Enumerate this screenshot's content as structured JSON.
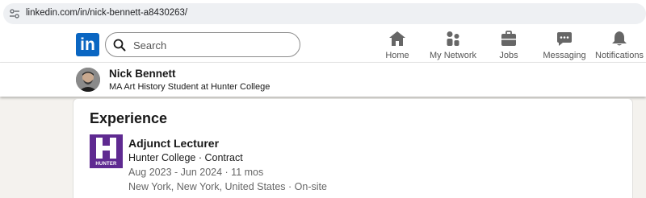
{
  "browser": {
    "url": "linkedin.com/in/nick-bennett-a8430263/"
  },
  "nav": {
    "logo_text": "in",
    "search_placeholder": "Search",
    "items": [
      {
        "label": "Home",
        "icon": "home-icon"
      },
      {
        "label": "My Network",
        "icon": "network-icon"
      },
      {
        "label": "Jobs",
        "icon": "briefcase-icon"
      },
      {
        "label": "Messaging",
        "icon": "messaging-icon"
      },
      {
        "label": "Notifications",
        "icon": "bell-icon"
      }
    ]
  },
  "profile": {
    "name": "Nick Bennett",
    "headline": "MA Art History Student at Hunter College"
  },
  "experience": {
    "title": "Experience",
    "entries": [
      {
        "logo_caption": "HUNTER",
        "role": "Adjunct Lecturer",
        "organization": "Hunter College · Contract",
        "dates": "Aug 2023 - Jun 2024 · 11 mos",
        "location": "New York, New York, United States · On-site"
      }
    ]
  },
  "colors": {
    "brand": "#0a66c2",
    "hunter_purple": "#5f2a91",
    "page_bg": "#f4f2ee"
  }
}
